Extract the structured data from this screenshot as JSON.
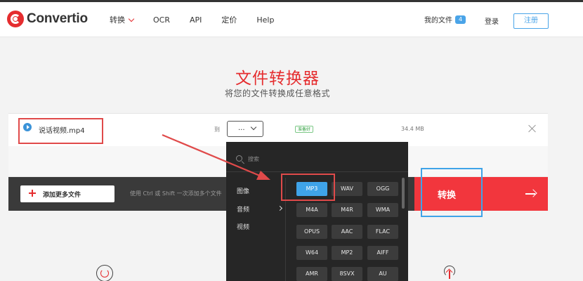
{
  "header": {
    "logo_text": "Convertio",
    "nav": [
      {
        "label": "转换"
      },
      {
        "label": "OCR"
      },
      {
        "label": "API"
      },
      {
        "label": "定价"
      },
      {
        "label": "Help"
      }
    ],
    "my_files_label": "我的文件",
    "my_files_count": "4",
    "login_label": "登录",
    "register_label": "注册"
  },
  "hero": {
    "title": "文件转换器",
    "subtitle": "将您的文件转换成任意格式"
  },
  "file_row": {
    "file_name": "说话视频.mp4",
    "to_label": "到",
    "selected_format": "...",
    "status": "准备好",
    "size": "34.4 MB"
  },
  "action_bar": {
    "add_button_label": "添加更多文件",
    "hint": "使用 Ctrl 或 Shift 一次添加多个文件",
    "convert_button_label": "转换"
  },
  "dropdown": {
    "search_placeholder": "搜索",
    "categories": [
      "图像",
      "音频",
      "视频"
    ],
    "formats": [
      "MP3",
      "WAV",
      "OGG",
      "M4A",
      "M4R",
      "WMA",
      "OPUS",
      "AAC",
      "FLAC",
      "W64",
      "MP2",
      "AIFF",
      "AMR",
      "8SVX",
      "AU"
    ],
    "selected_format": "MP3"
  },
  "colors": {
    "brand_red": "#e52d2f",
    "accent_blue": "#3fa3e8",
    "dropdown_bg": "#262626"
  }
}
